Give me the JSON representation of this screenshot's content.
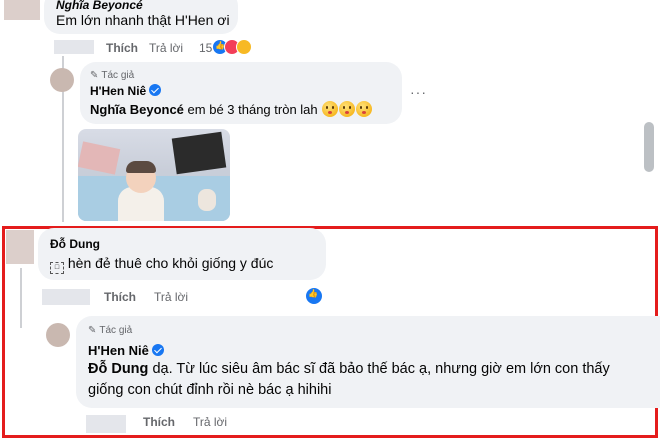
{
  "comments": [
    {
      "author": "Nghĩa Beyoncé",
      "text": "Em lớn nhanh thật H'Hen ơi",
      "actions": {
        "like": "Thích",
        "reply": "Trả lời"
      },
      "reaction_count": "15",
      "reactions": [
        "like-icon",
        "love-icon",
        "care-icon"
      ]
    },
    {
      "badge": "Tác giả",
      "author": "H'Hen Niê",
      "mention": "Nghĩa Beyoncé",
      "text": "em bé 3 tháng tròn lah",
      "emojis": [
        "kiss-emoji",
        "kiss-emoji",
        "kiss-emoji"
      ],
      "more": "···"
    },
    {
      "author": "Đỗ Dung",
      "text": "hèn đẻ thuê cho khỏi giống y đúc",
      "actions": {
        "like": "Thích",
        "reply": "Trả lời"
      },
      "reactions": [
        "like-icon"
      ]
    },
    {
      "badge": "Tác giả",
      "author": "H'Hen Niê",
      "mention": "Đỗ Dung",
      "text_line1": "dạ. Từ lúc siêu âm bác sĩ đã bảo thế bác ạ, nhưng giờ em lớn con thấy",
      "text_line2": "giống con chút đỉnh rồi nè bác ạ hihihi",
      "actions": {
        "like": "Thích",
        "reply": "Trả lời"
      }
    }
  ],
  "colors": {
    "highlight": "#e41c1c",
    "bubble": "#f0f2f5",
    "verified": "#1877f2"
  }
}
